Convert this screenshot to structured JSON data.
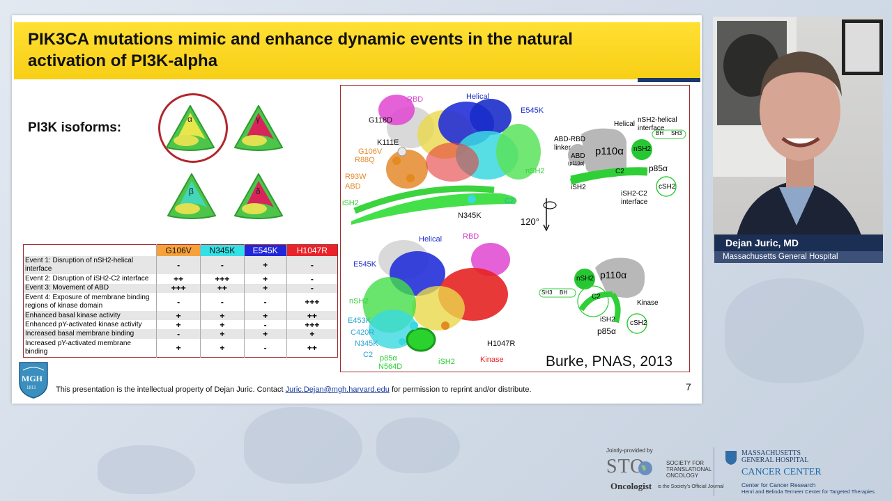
{
  "slide": {
    "title": "PIK3CA mutations mimic and enhance dynamic events in the natural activation of PI3K-alpha",
    "isoforms_label": "PI3K isoforms:",
    "isoforms": [
      {
        "letter": "α"
      },
      {
        "letter": "γ"
      },
      {
        "letter": "β"
      },
      {
        "letter": "δ"
      }
    ],
    "table": {
      "columns": [
        {
          "label": "G106V",
          "color": "#f6a23a"
        },
        {
          "label": "N345K",
          "color": "#32e0e6"
        },
        {
          "label": "E545K",
          "color": "#2127d9"
        },
        {
          "label": "H1047R",
          "color": "#e8242a"
        }
      ],
      "rows": [
        {
          "event": "Event 1: Disruption of nSH2-helical interface",
          "vals": [
            "-",
            "-",
            "+",
            "-"
          ]
        },
        {
          "event": "Event 2: Disruption of iSH2-C2 interface",
          "vals": [
            "++",
            "+++",
            "+",
            "-"
          ]
        },
        {
          "event": "Event 3: Movement of ABD",
          "vals": [
            "+++",
            "++",
            "+",
            "-"
          ]
        },
        {
          "event": "Event 4: Exposure of membrane binding regions of kinase domain",
          "vals": [
            "-",
            "-",
            "-",
            "+++"
          ]
        },
        {
          "event": "Enhanced basal kinase activity",
          "vals": [
            "+",
            "+",
            "+",
            "++"
          ]
        },
        {
          "event": "Enhanced pY-activated kinase activity",
          "vals": [
            "+",
            "+",
            "-",
            "+++"
          ]
        },
        {
          "event": "Increased basal membrane binding",
          "vals": [
            "-",
            "+",
            "+",
            "+"
          ]
        },
        {
          "event": "Increased pY-activated membrane binding",
          "vals": [
            "+",
            "+",
            "-",
            "++"
          ]
        }
      ]
    },
    "figure": {
      "labels_top": {
        "rbd": "RBD",
        "helical": "Helical",
        "e545k": "E545K",
        "g118d": "G118D",
        "k111e": "K111E",
        "g106v": "G106V",
        "r88q": "R88Q",
        "r93w": "R93W",
        "abd": "ABD",
        "ish2": "iSH2",
        "nsh2": "nSH2",
        "c2": "C2",
        "n345k": "N345K"
      },
      "labels_bottom": {
        "helical": "Helical",
        "rbd": "RBD",
        "e545k": "E545K",
        "nsh2": "nSH2",
        "e453k": "E453K",
        "c420r": "C420R",
        "n345k": "N345K",
        "c2": "C2",
        "p85a": "p85α",
        "n564d": "N564D",
        "ish2": "iSH2",
        "kinase": "Kinase",
        "h1047r": "H1047R"
      },
      "schematic_top": {
        "helical": "Helical",
        "nsh2_helical": "nSH2-helical",
        "interface": "interface",
        "abd_rbd": "ABD-RBD",
        "linker": "linker",
        "abd": "ABD",
        "p110a_small": "(p110α)",
        "p110a": "p110α",
        "nsh2": "nSH2",
        "bh": "BH",
        "sh3": "SH3",
        "c2": "C2",
        "p85a": "p85α",
        "ish2": "iSH2",
        "ish2_c2": "iSH2-C2",
        "interface2": "interface",
        "csh2": "cSH2"
      },
      "rotation": "120°",
      "schematic_bottom": {
        "p110a": "p110α",
        "nsh2": "nSH2",
        "sh3": "SH3",
        "bh": "BH",
        "c2": "C2",
        "kinase": "Kinase",
        "ish2": "iSH2",
        "csh2": "cSH2",
        "p85a": "p85α"
      },
      "citation": "Burke, PNAS, 2013"
    },
    "logo": {
      "mgh": "MGH",
      "year": "1811"
    },
    "footer": {
      "prefix": "This presentation is the intellectual property of Dejan Juric. Contact ",
      "email": "Juric.Dejan@mgh.harvard.edu",
      "suffix": " for permission to reprint and/or distribute."
    },
    "page_number": "7"
  },
  "speaker": {
    "name": "Dejan Juric, MD",
    "affiliation": "Massachusetts General Hospital"
  },
  "sponsors": {
    "jointly": "Jointly-provided by",
    "sto": "STO",
    "sto_line1": "SOCIETY FOR",
    "sto_line2": "TRANSLATIONAL",
    "sto_line3": "ONCOLOGY",
    "oncologist": "Oncologist",
    "oncologist_tag": "is the Society's Official Journal",
    "mgh_line1": "MASSACHUSETTS",
    "mgh_line2": "GENERAL HOSPITAL",
    "cancer_center": "CANCER CENTER",
    "ccr": "Center for Cancer Research",
    "termeer": "Henri and Belinda Termeer Center for Targeted Therapies"
  }
}
